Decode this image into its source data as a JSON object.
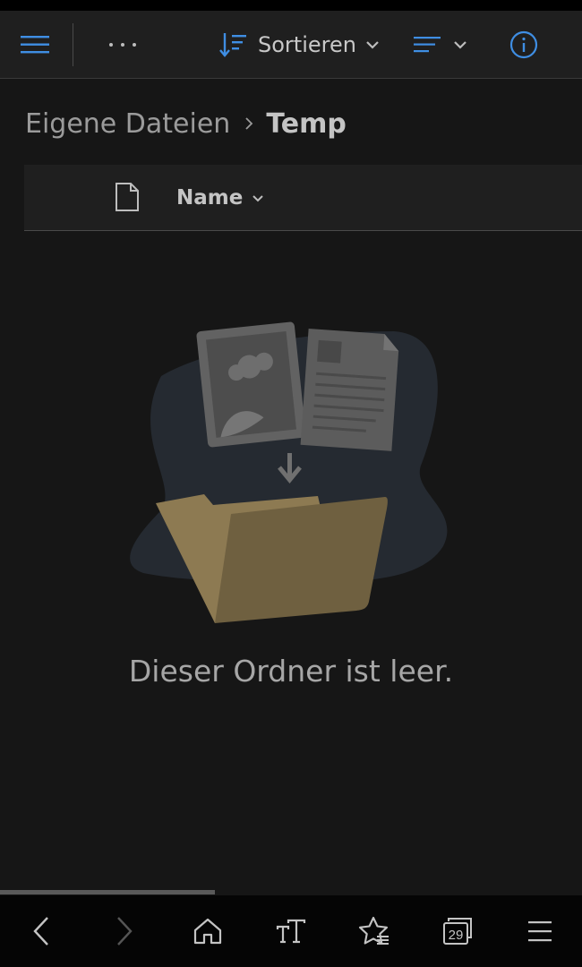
{
  "toolbar": {
    "menu_icon": "hamburger-menu-icon",
    "more_icon": "more-horizontal-icon",
    "sort_label": "Sortieren",
    "sort_icon": "sort-descending-icon",
    "view_icon": "view-lines-icon",
    "info_icon": "info-icon",
    "accent_color": "#3f8ee3"
  },
  "breadcrumb": {
    "root": "Eigene Dateien",
    "separator_icon": "chevron-right-icon",
    "current": "Temp"
  },
  "list_header": {
    "file_icon": "file-type-icon",
    "name_label": "Name",
    "name_sort_icon": "chevron-down-icon"
  },
  "empty_state": {
    "illustration": "empty-folder-illustration",
    "message": "Dieser Ordner ist leer."
  },
  "bottom_nav": {
    "items": [
      {
        "icon": "back-icon"
      },
      {
        "icon": "forward-icon"
      },
      {
        "icon": "home-icon"
      },
      {
        "icon": "text-size-icon"
      },
      {
        "icon": "favorites-icon"
      },
      {
        "icon": "tabs-icon",
        "count": "29"
      },
      {
        "icon": "menu-icon"
      }
    ]
  }
}
